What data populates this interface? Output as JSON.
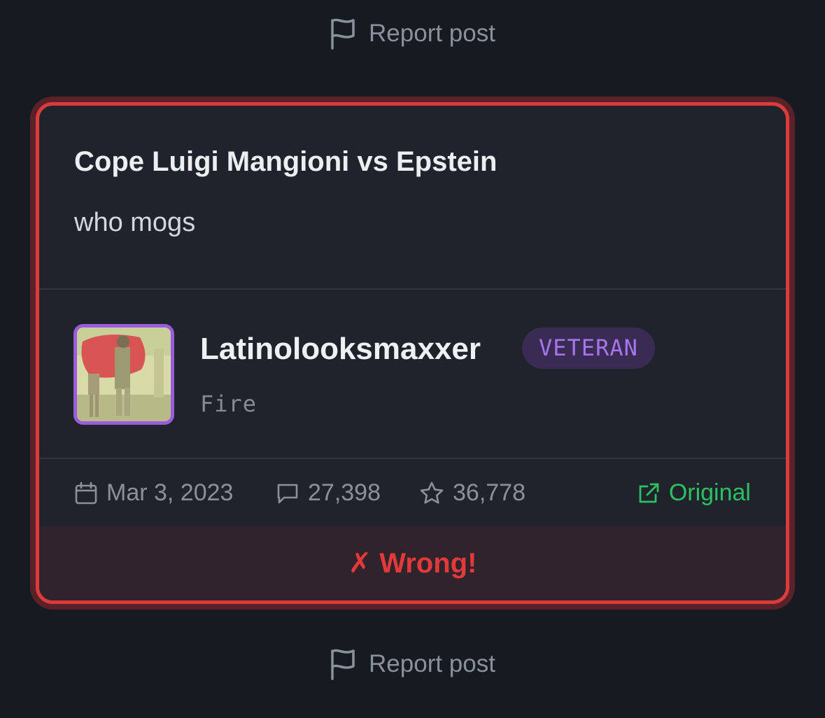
{
  "report_top": {
    "label": "Report post",
    "icon": "flag-icon"
  },
  "report_bottom": {
    "label": "Report post",
    "icon": "flag-icon"
  },
  "post": {
    "title": "Cope Luigi Mangioni vs Epstein",
    "body": "who mogs"
  },
  "author": {
    "name": "Latinolooksmaxxer",
    "badge": "VETERAN",
    "subtitle": "Fire",
    "avatar_border_color": "#9a5cdc"
  },
  "meta": {
    "date": "Mar 3, 2023",
    "comments": "27,398",
    "stars": "36,778",
    "original_label": "Original"
  },
  "result": {
    "label": "✗ Wrong!",
    "color": "#e2393b"
  },
  "colors": {
    "background": "#161a21",
    "card": "#1f232b",
    "card_border": "#dc3b3c",
    "accent_green": "#2fbf63",
    "badge_text": "#a675ea",
    "badge_bg": "#3a2b55"
  }
}
